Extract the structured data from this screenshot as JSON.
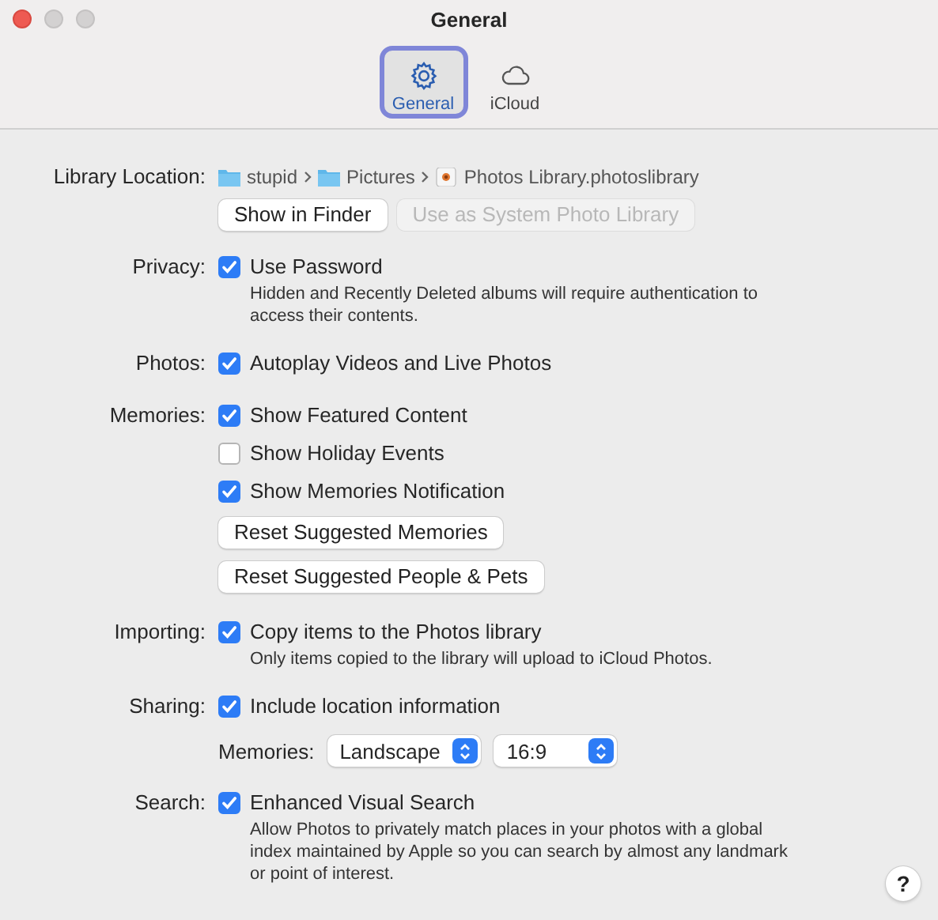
{
  "window": {
    "title": "General"
  },
  "tabs": [
    {
      "label": "General",
      "kind": "gear",
      "selected": true
    },
    {
      "label": "iCloud",
      "kind": "cloud",
      "selected": false
    }
  ],
  "sections": [
    {
      "label": "Library Location:",
      "rows": [
        {
          "kind": "path",
          "items": [
            {
              "kind": "folder",
              "name": "stupid"
            },
            {
              "kind": "folder",
              "name": "Pictures"
            },
            {
              "kind": "library",
              "name": "Photos Library.photoslibrary"
            }
          ]
        },
        {
          "kind": "buttons",
          "buttons": [
            {
              "label": "Show in Finder",
              "disabled": false
            },
            {
              "label": "Use as System Photo Library",
              "disabled": true
            }
          ]
        }
      ]
    },
    {
      "label": "Privacy:",
      "rows": [
        {
          "kind": "checkbox",
          "label": "Use Password",
          "checked": true
        },
        {
          "kind": "note",
          "text": "Hidden and Recently Deleted albums will require authentication to access their contents."
        }
      ]
    },
    {
      "label": "Photos:",
      "rows": [
        {
          "kind": "checkbox",
          "label": "Autoplay Videos and Live Photos",
          "checked": true
        }
      ]
    },
    {
      "label": "Memories:",
      "rows": [
        {
          "kind": "checkbox",
          "label": "Show Featured Content",
          "checked": true
        },
        {
          "kind": "checkbox",
          "label": "Show Holiday Events",
          "checked": false
        },
        {
          "kind": "checkbox",
          "label": "Show Memories Notification",
          "checked": true
        },
        {
          "kind": "button",
          "label": "Reset Suggested Memories",
          "disabled": false
        },
        {
          "kind": "button",
          "label": "Reset Suggested People & Pets",
          "disabled": false
        }
      ]
    },
    {
      "label": "Importing:",
      "rows": [
        {
          "kind": "checkbox",
          "label": "Copy items to the Photos library",
          "checked": true
        },
        {
          "kind": "note",
          "text": "Only items copied to the library will upload to iCloud Photos."
        }
      ]
    },
    {
      "label": "Sharing:",
      "rows": [
        {
          "kind": "checkbox",
          "label": "Include location information",
          "checked": true
        },
        {
          "kind": "popups",
          "label": "Memories:",
          "popups": [
            "Landscape",
            "16:9"
          ]
        }
      ]
    },
    {
      "label": "Search:",
      "rows": [
        {
          "kind": "checkbox",
          "label": "Enhanced Visual Search",
          "checked": true
        },
        {
          "kind": "note",
          "text": "Allow Photos to privately match places in your photos with a global index maintained by Apple so you can search by almost any landmark or point of interest."
        }
      ]
    }
  ],
  "help": {
    "label": "?"
  }
}
